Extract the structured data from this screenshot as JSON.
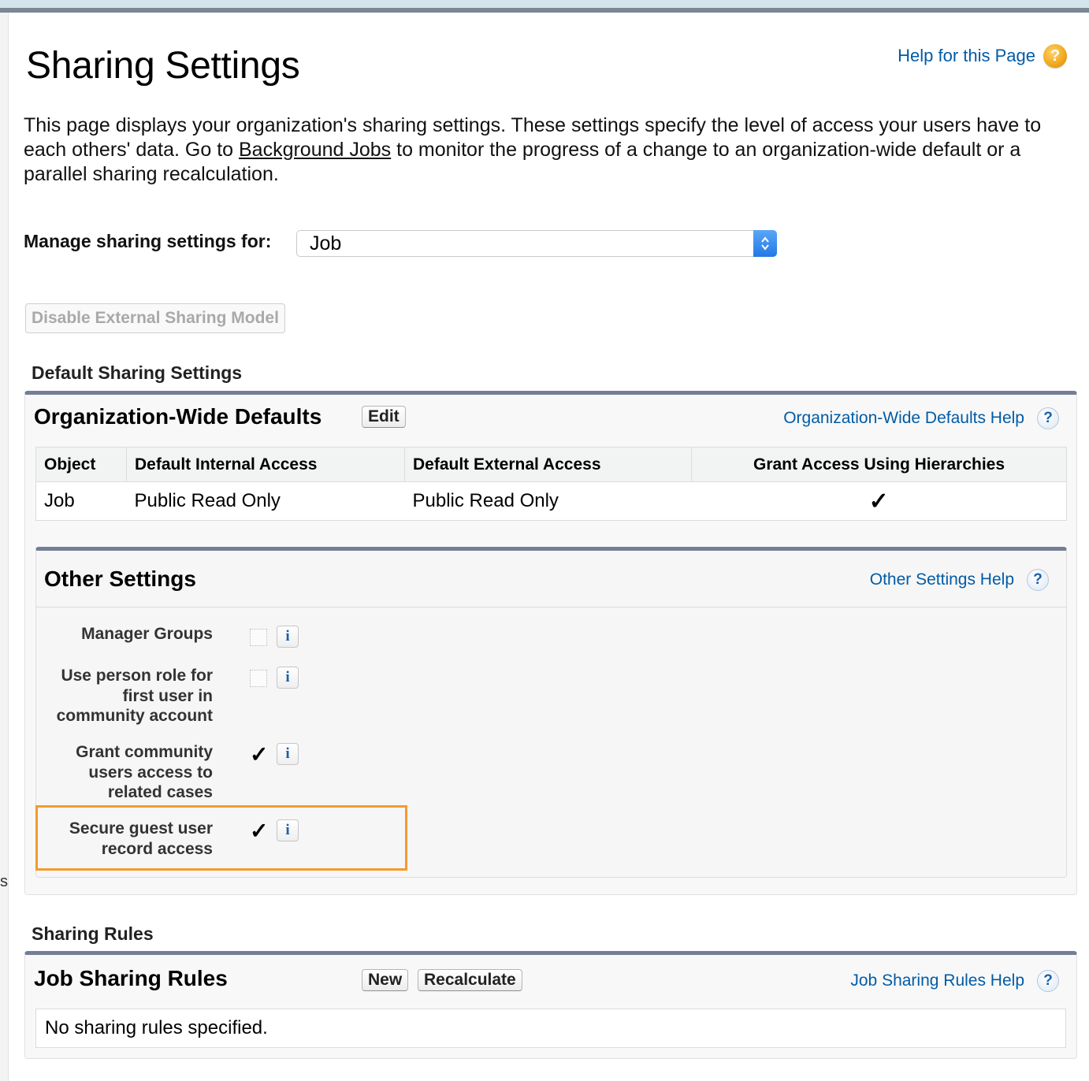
{
  "page": {
    "title": "Sharing Settings",
    "help_link": "Help for this Page",
    "intro_before": "This page displays your organization's sharing settings. These settings specify the level of access your users have to each others' data. Go to ",
    "intro_link": "Background Jobs",
    "intro_after": " to monitor the progress of a change to an organization-wide default or a parallel sharing recalculation.",
    "manage_label": "Manage sharing settings for:",
    "manage_selected": "Job",
    "disable_button": "Disable External Sharing Model",
    "left_edge_char": "s"
  },
  "default_sharing": {
    "heading": "Default Sharing Settings",
    "org_wide": {
      "title": "Organization-Wide Defaults",
      "edit_button": "Edit",
      "help_link": "Organization-Wide Defaults Help",
      "columns": [
        "Object",
        "Default Internal Access",
        "Default External Access",
        "Grant Access Using Hierarchies"
      ],
      "rows": [
        {
          "object": "Job",
          "internal": "Public Read Only",
          "external": "Public Read Only",
          "grant_hierarchies": true
        }
      ]
    },
    "other_settings": {
      "title": "Other Settings",
      "help_link": "Other Settings Help",
      "items": [
        {
          "label": "Manager Groups",
          "checked": false
        },
        {
          "label": "Use person role for first user in community account",
          "checked": false
        },
        {
          "label": "Grant community users access to related cases",
          "checked": true
        },
        {
          "label": "Secure guest user record access",
          "checked": true,
          "highlighted": true
        }
      ]
    }
  },
  "sharing_rules": {
    "heading": "Sharing Rules",
    "title": "Job Sharing Rules",
    "new_button": "New",
    "recalculate_button": "Recalculate",
    "help_link": "Job Sharing Rules Help",
    "empty_text": "No sharing rules specified."
  },
  "icons": {
    "help_page": "help-orange-icon",
    "help": "help-question-icon",
    "info": "info-icon",
    "checkmark": "checkmark-icon",
    "select": "select-arrows-icon"
  },
  "colors": {
    "link": "#015ba7",
    "panel_border": "#747e96",
    "highlight": "#f39b2d"
  }
}
